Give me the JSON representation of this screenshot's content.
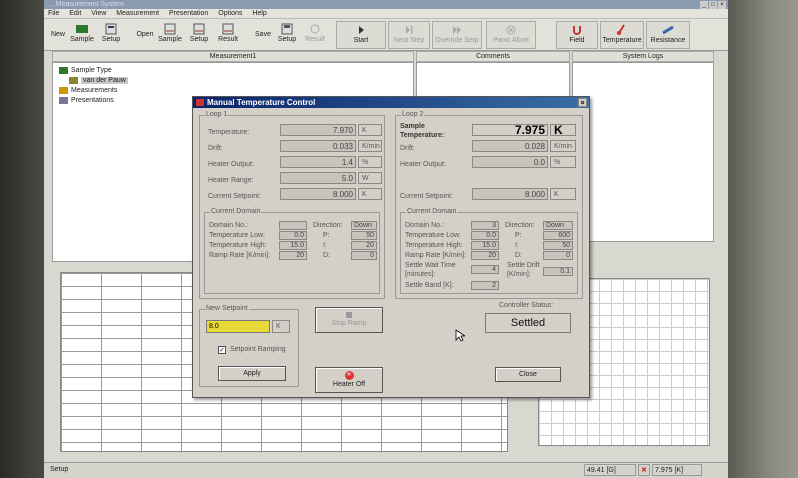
{
  "menu": [
    "File",
    "Edit",
    "View",
    "Measurement",
    "Presentation",
    "Options",
    "Help"
  ],
  "window_title": "... Measurement System",
  "toolbar": {
    "new_label": "New",
    "new_sample": "Sample",
    "new_setup": "Setup",
    "open_label": "Open",
    "open_sample": "Sample",
    "open_setup": "Setup",
    "open_result": "Result",
    "save_label": "Save",
    "save_setup": "Setup",
    "save_result": "Result",
    "start": "Start",
    "next_step": "Next Step",
    "override_setp": "Override Setp",
    "panic_abort": "Panic Abort",
    "field": "Field",
    "temperature": "Temperature",
    "resistance": "Resistance"
  },
  "panels": {
    "measurement": "Measurement1",
    "comments": "Comments",
    "system_logs": "System Logs"
  },
  "tree": {
    "sample_type": "Sample Type",
    "van_der_pauw": "van der Pauw",
    "measurements": "Measurements",
    "presentations": "Presentations"
  },
  "status_bar": {
    "left": "Setup",
    "coords": "49.41 [G]",
    "temp": "7.975 [K]"
  },
  "dialog": {
    "title": "Manual Temperature Control",
    "loop1": {
      "label": "Loop 1",
      "temperature_label": "Temperature:",
      "temperature_value": "7.970",
      "temperature_unit": "K",
      "drift_label": "Drift:",
      "drift_value": "0.033",
      "drift_unit": "K/min",
      "heater_output_label": "Heater Output:",
      "heater_output_value": "1.4",
      "heater_output_unit": "%",
      "heater_range_label": "Heater Range:",
      "heater_range_value": "5.0",
      "heater_range_unit": "W",
      "setpoint_label": "Current Setpoint:",
      "setpoint_value": "8.000",
      "setpoint_unit": "K",
      "domain": {
        "label": "Current Domain",
        "domain_no_label": "Domain No.:",
        "domain_no": "",
        "temp_low_label": "Temperature Low:",
        "temp_low": "0.0",
        "temp_high_label": "Temperature High:",
        "temp_high": "15.0",
        "ramp_rate_label": "Ramp Rate [K/min]:",
        "ramp_rate": "20",
        "direction_label": "Direction:",
        "direction": "Down",
        "p_label": "P:",
        "p": "50",
        "i_label": "I:",
        "i": "20",
        "d_label": "D:",
        "d": "0"
      }
    },
    "loop2": {
      "label": "Loop 2",
      "sample_temp_label": "Sample Temperature:",
      "sample_temp_value": "7.975",
      "sample_temp_unit": "K",
      "drift_label": "Drift:",
      "drift_value": "0.028",
      "drift_unit": "K/min",
      "heater_output_label": "Heater Output:",
      "heater_output_value": "0.0",
      "heater_output_unit": "%",
      "setpoint_label": "Current Setpoint:",
      "setpoint_value": "8.000",
      "setpoint_unit": "K",
      "domain": {
        "label": "Current Domain",
        "domain_no_label": "Domain No.:",
        "domain_no": "3",
        "temp_low_label": "Temperature Low:",
        "temp_low": "0.0",
        "temp_high_label": "Temperature High:",
        "temp_high": "15.0",
        "ramp_rate_label": "Ramp Rate [K/min]:",
        "ramp_rate": "20",
        "direction_label": "Direction:",
        "direction": "Down",
        "p_label": "P:",
        "p": "600",
        "i_label": "I:",
        "i": "50",
        "d_label": "D:",
        "d": "0",
        "settle_wait_label": "Settle Wait Time [minutes]:",
        "settle_wait": "4",
        "settle_drift_label": "Settle Drift [K/min]:",
        "settle_drift": "0.1",
        "settle_band_label": "Settle Band [K]:",
        "settle_band": "2"
      }
    },
    "new_setpoint": {
      "label": "New Setpoint",
      "value": "8.0",
      "unit": "K",
      "ramping_label": "Setpoint Ramping",
      "ramping_checked": true
    },
    "stop_ramp": "Stop Ramp",
    "apply": "Apply",
    "heater_off": "Heater Off",
    "controller_status_label": "Controller Status:",
    "controller_status": "Settled",
    "close": "Close"
  }
}
